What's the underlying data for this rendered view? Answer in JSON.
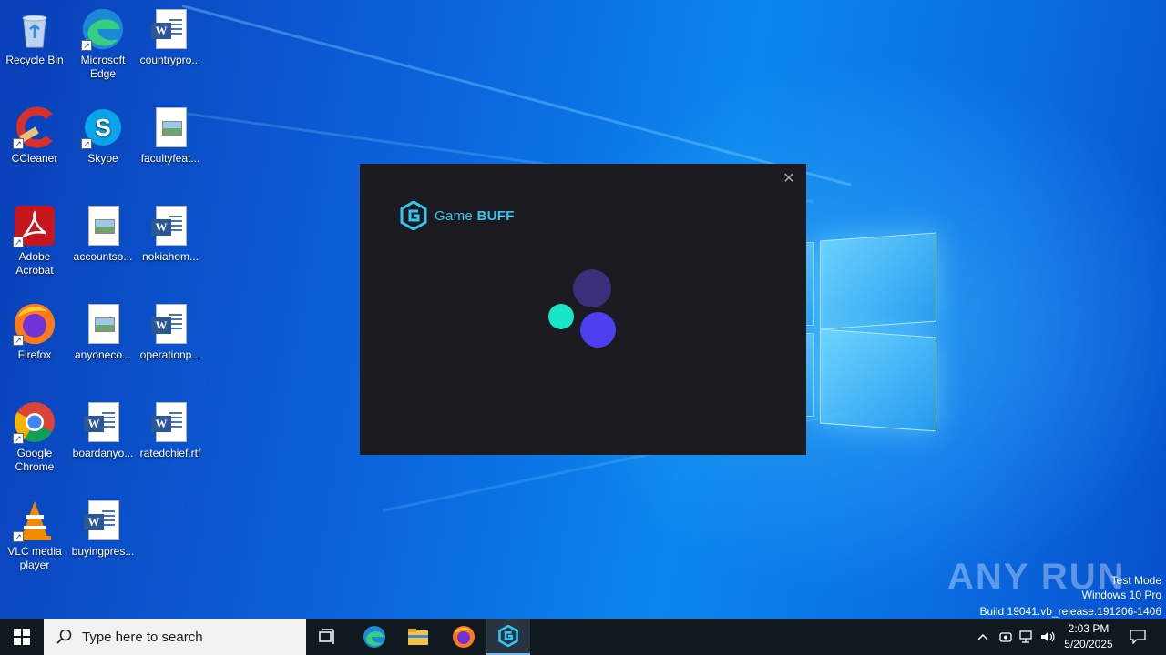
{
  "desktop": {
    "icons": [
      {
        "label": "Recycle Bin",
        "icon": "recycle-bin-icon"
      },
      {
        "label": "Microsoft Edge",
        "icon": "edge-icon"
      },
      {
        "label": "countrypro...",
        "icon": "word-doc-icon"
      },
      {
        "label": "CCleaner",
        "icon": "ccleaner-icon"
      },
      {
        "label": "Skype",
        "icon": "skype-icon"
      },
      {
        "label": "facultyfeat...",
        "icon": "image-file-icon"
      },
      {
        "label": "Adobe Acrobat",
        "icon": "acrobat-icon"
      },
      {
        "label": "accountso...",
        "icon": "image-file-icon"
      },
      {
        "label": "nokiahom...",
        "icon": "word-doc-icon"
      },
      {
        "label": "Firefox",
        "icon": "firefox-icon"
      },
      {
        "label": "anyoneco...",
        "icon": "image-file-icon"
      },
      {
        "label": "operationp...",
        "icon": "word-doc-icon"
      },
      {
        "label": "Google Chrome",
        "icon": "chrome-icon"
      },
      {
        "label": "boardanyo...",
        "icon": "word-doc-icon"
      },
      {
        "label": "ratedchief.rtf",
        "icon": "word-doc-icon"
      },
      {
        "label": "VLC media player",
        "icon": "vlc-icon"
      },
      {
        "label": "buyingpres...",
        "icon": "word-doc-icon"
      }
    ]
  },
  "splash": {
    "brand_light": "Game ",
    "brand_bold": "BUFF",
    "close_glyph": "✕",
    "loader_colors": {
      "top": "#3a2f78",
      "left": "#17e5c8",
      "right": "#4c3ff0"
    },
    "accent": "#31c7f2"
  },
  "watermark": {
    "logo": "ANY RUN",
    "line1": "Test Mode",
    "line2": "Windows 10 Pro",
    "line3": "Build 19041.vb_release.191206-1406"
  },
  "taskbar": {
    "search_placeholder": "Type here to search",
    "apps": [
      "task-view-icon",
      "edge-icon",
      "file-explorer-icon",
      "firefox-icon",
      "gamebuff-icon"
    ],
    "time": "2:03 PM",
    "date": "5/20/2025"
  }
}
